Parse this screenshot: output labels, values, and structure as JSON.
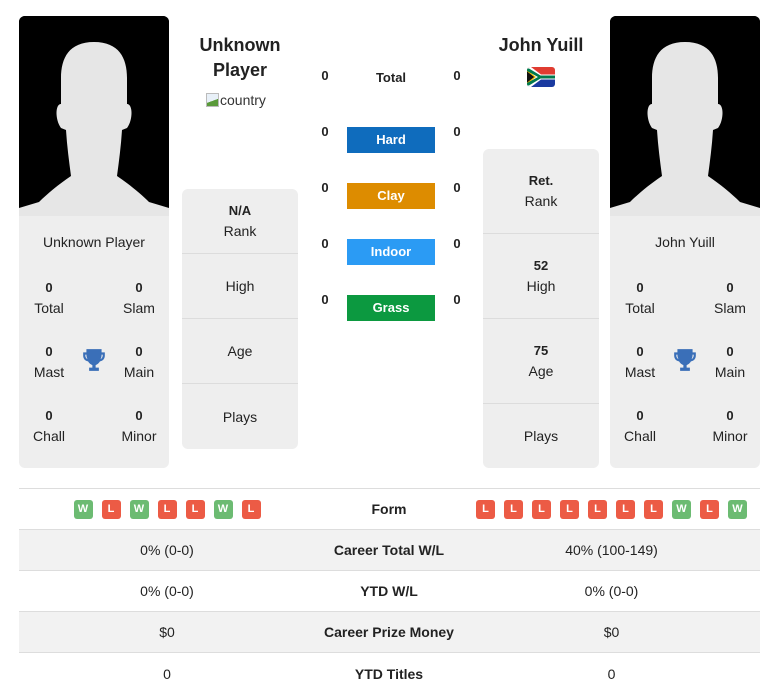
{
  "players": [
    {
      "name": "Unknown Player",
      "header_name_line1": "Unknown",
      "header_name_line2": "Player",
      "country_alt": "country",
      "titles": {
        "total": {
          "value": "0",
          "label": "Total"
        },
        "slam": {
          "value": "0",
          "label": "Slam"
        },
        "mast": {
          "value": "0",
          "label": "Mast"
        },
        "main": {
          "value": "0",
          "label": "Main"
        },
        "chall": {
          "value": "0",
          "label": "Chall"
        },
        "minor": {
          "value": "0",
          "label": "Minor"
        }
      },
      "rank": {
        "value": "N/A",
        "label": "Rank"
      },
      "high": {
        "value": "",
        "label": "High"
      },
      "age": {
        "value": "",
        "label": "Age"
      },
      "plays": {
        "value": "",
        "label": "Plays"
      },
      "form": [
        "W",
        "L",
        "W",
        "L",
        "L",
        "W",
        "L"
      ],
      "career_total_wl": "0% (0-0)",
      "ytd_wl": "0% (0-0)",
      "career_prize_money": "$0",
      "ytd_titles": "0"
    },
    {
      "name": "John Yuill",
      "header_name": "John Yuill",
      "country_flag": "south-africa",
      "titles": {
        "total": {
          "value": "0",
          "label": "Total"
        },
        "slam": {
          "value": "0",
          "label": "Slam"
        },
        "mast": {
          "value": "0",
          "label": "Mast"
        },
        "main": {
          "value": "0",
          "label": "Main"
        },
        "chall": {
          "value": "0",
          "label": "Chall"
        },
        "minor": {
          "value": "0",
          "label": "Minor"
        }
      },
      "rank": {
        "value": "Ret.",
        "label": "Rank"
      },
      "high": {
        "value": "52",
        "label": "High"
      },
      "age": {
        "value": "75",
        "label": "Age"
      },
      "plays": {
        "value": "",
        "label": "Plays"
      },
      "form": [
        "L",
        "L",
        "L",
        "L",
        "L",
        "L",
        "L",
        "W",
        "L",
        "W"
      ],
      "career_total_wl": "40% (100-149)",
      "ytd_wl": "0% (0-0)",
      "career_prize_money": "$0",
      "ytd_titles": "0"
    }
  ],
  "surfaces": [
    {
      "label": "Total",
      "p1": "0",
      "p2": "0",
      "color": null
    },
    {
      "label": "Hard",
      "p1": "0",
      "p2": "0",
      "color": "#0f6cbd"
    },
    {
      "label": "Clay",
      "p1": "0",
      "p2": "0",
      "color": "#dd8c00"
    },
    {
      "label": "Indoor",
      "p1": "0",
      "p2": "0",
      "color": "#2b9bf4"
    },
    {
      "label": "Grass",
      "p1": "0",
      "p2": "0",
      "color": "#0c9940"
    }
  ],
  "table_labels": {
    "form": "Form",
    "career_total_wl": "Career Total W/L",
    "ytd_wl": "YTD W/L",
    "career_prize_money": "Career Prize Money",
    "ytd_titles": "YTD Titles"
  },
  "colors": {
    "win": "#6cbb72",
    "loss": "#ec5b45",
    "trophy": "#3a6fb8",
    "card_bg": "#eeeeee"
  }
}
